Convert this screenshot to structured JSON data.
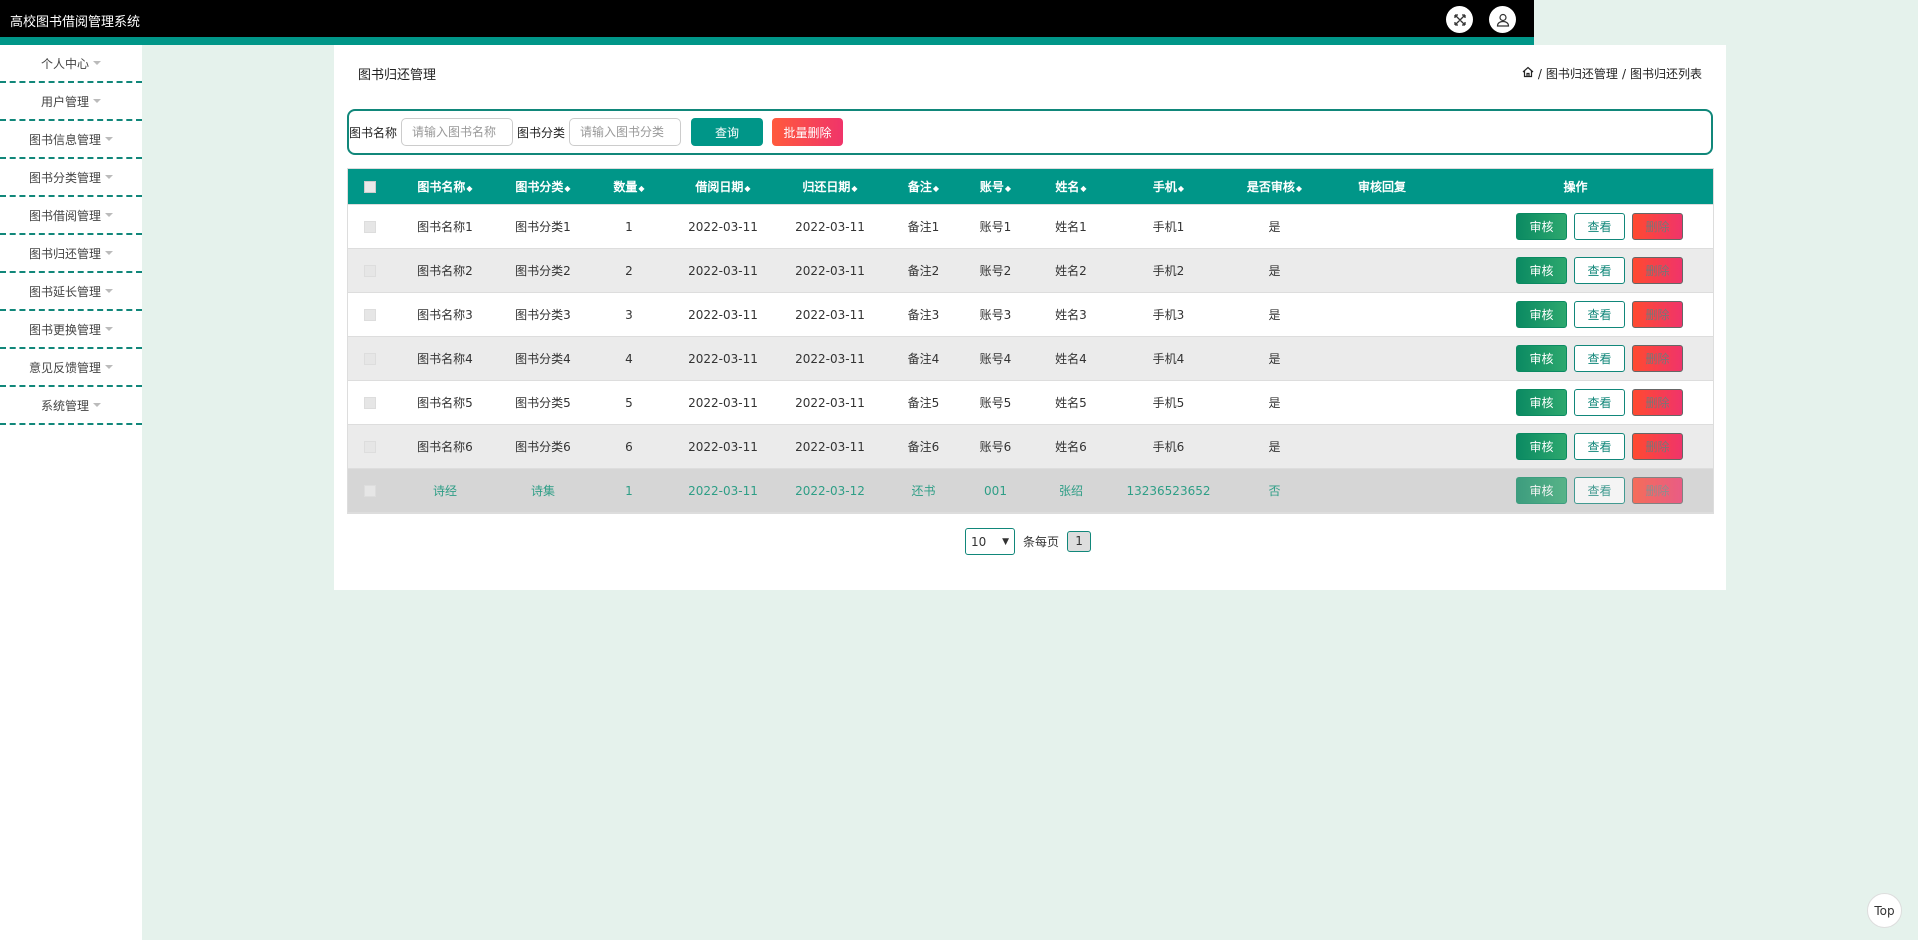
{
  "header": {
    "title": "高校图书借阅管理系统"
  },
  "sidebar": {
    "items": [
      {
        "label": "个人中心"
      },
      {
        "label": "用户管理"
      },
      {
        "label": "图书信息管理"
      },
      {
        "label": "图书分类管理"
      },
      {
        "label": "图书借阅管理"
      },
      {
        "label": "图书归还管理"
      },
      {
        "label": "图书延长管理"
      },
      {
        "label": "图书更换管理"
      },
      {
        "label": "意见反馈管理"
      },
      {
        "label": "系统管理"
      }
    ]
  },
  "page": {
    "title": "图书归还管理",
    "breadcrumb": [
      "/",
      "图书归还管理",
      "/",
      "图书归还列表"
    ]
  },
  "search": {
    "name_label": "图书名称",
    "name_placeholder": "请输入图书名称",
    "cat_label": "图书分类",
    "cat_placeholder": "请输入图书分类",
    "query": "查询",
    "batch_delete": "批量删除"
  },
  "table": {
    "columns": [
      "图书名称",
      "图书分类",
      "数量",
      "借阅日期",
      "归还日期",
      "备注",
      "账号",
      "姓名",
      "手机",
      "是否审核",
      "审核回复",
      "操作"
    ],
    "rows": [
      [
        "图书名称1",
        "图书分类1",
        "1",
        "2022-03-11",
        "2022-03-11",
        "备注1",
        "账号1",
        "姓名1",
        "手机1",
        "是",
        ""
      ],
      [
        "图书名称2",
        "图书分类2",
        "2",
        "2022-03-11",
        "2022-03-11",
        "备注2",
        "账号2",
        "姓名2",
        "手机2",
        "是",
        ""
      ],
      [
        "图书名称3",
        "图书分类3",
        "3",
        "2022-03-11",
        "2022-03-11",
        "备注3",
        "账号3",
        "姓名3",
        "手机3",
        "是",
        ""
      ],
      [
        "图书名称4",
        "图书分类4",
        "4",
        "2022-03-11",
        "2022-03-11",
        "备注4",
        "账号4",
        "姓名4",
        "手机4",
        "是",
        ""
      ],
      [
        "图书名称5",
        "图书分类5",
        "5",
        "2022-03-11",
        "2022-03-11",
        "备注5",
        "账号5",
        "姓名5",
        "手机5",
        "是",
        ""
      ],
      [
        "图书名称6",
        "图书分类6",
        "6",
        "2022-03-11",
        "2022-03-11",
        "备注6",
        "账号6",
        "姓名6",
        "手机6",
        "是",
        ""
      ],
      [
        "诗经",
        "诗集",
        "1",
        "2022-03-11",
        "2022-03-12",
        "还书",
        "001",
        "张绍",
        "13236523652",
        "否",
        ""
      ]
    ],
    "actions": [
      "审核",
      "查看",
      "删除"
    ]
  },
  "pagination": {
    "page_size": "10",
    "per_page_label": "条每页",
    "current_page": "1"
  },
  "back_to_top": "Top"
}
